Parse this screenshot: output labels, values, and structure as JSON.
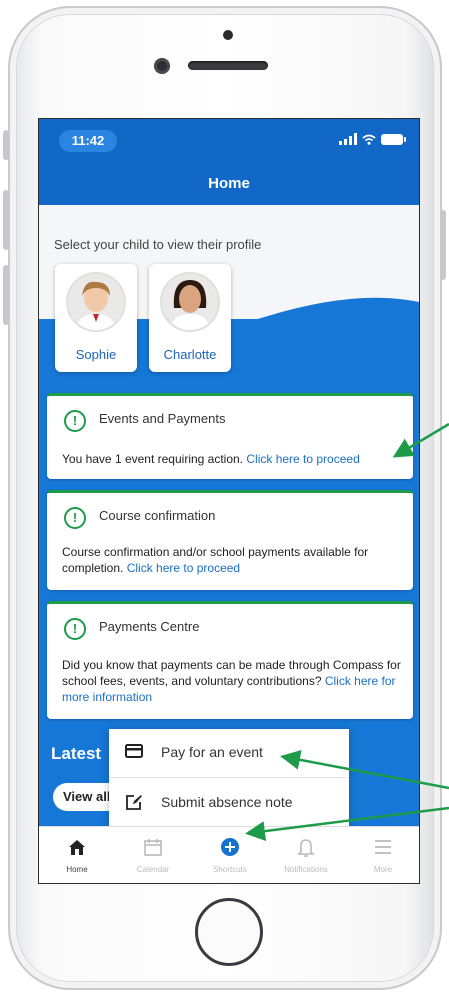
{
  "status_bar": {
    "time": "11:42"
  },
  "header": {
    "title": "Home"
  },
  "profile": {
    "prompt": "Select your child to view their profile",
    "children": [
      {
        "name": "Sophie"
      },
      {
        "name": "Charlotte"
      }
    ]
  },
  "cards": [
    {
      "title": "Events and Payments",
      "text": "You have 1 event requiring action. ",
      "link": "Click here to proceed"
    },
    {
      "title": "Course confirmation",
      "text": "Course confirmation and/or school payments available for completion. ",
      "link": "Click here to proceed"
    },
    {
      "title": "Payments Centre",
      "text": "Did you know that payments can be made through Compass for school fees, events, and voluntary contributions? ",
      "link": "Click here for more information"
    }
  ],
  "latest": {
    "heading": "Latest",
    "view_all": "View all"
  },
  "shortcuts_menu": [
    {
      "label": "Pay for an event",
      "icon": "card-icon"
    },
    {
      "label": "Submit absence note",
      "icon": "edit-note-icon"
    }
  ],
  "tabs": [
    {
      "label": "Home",
      "icon": "home-icon",
      "active": true
    },
    {
      "label": "Calendar",
      "icon": "calendar-icon",
      "active": false
    },
    {
      "label": "Shortcuts",
      "icon": "plus-circle-icon",
      "active": false
    },
    {
      "label": "Notifications",
      "icon": "bell-icon",
      "active": false
    },
    {
      "label": "More",
      "icon": "menu-icon",
      "active": false
    }
  ],
  "colors": {
    "brand_blue": "#1268c7",
    "accent_green": "#1e9b49",
    "link_blue": "#1b6fc4"
  }
}
